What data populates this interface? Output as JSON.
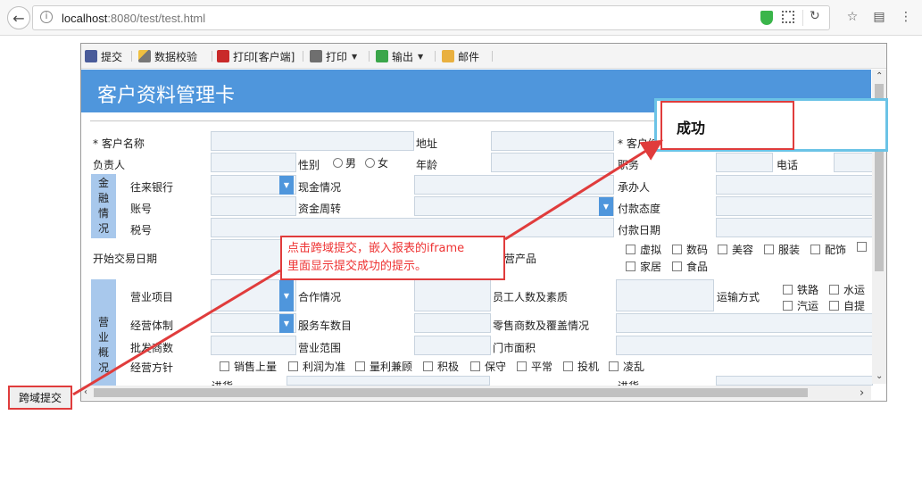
{
  "browser": {
    "url_host": "localhost",
    "url_path": ":8080/test/test.html"
  },
  "toolbar": {
    "submit": "提交",
    "validate": "数据校验",
    "print_client": "打印[客户端]",
    "print": "打印",
    "export": "输出",
    "mail": "邮件"
  },
  "form": {
    "title": "客户资料管理卡",
    "customer_name": "* 客户名称",
    "address": "地址",
    "customer_no": "* 客户编",
    "owner": "负责人",
    "gender": "性别",
    "male": "男",
    "female": "女",
    "age": "年龄",
    "position": "职务",
    "phone": "电话",
    "finance_side": [
      "金",
      "融",
      "情",
      "况"
    ],
    "bank": "往来银行",
    "cash": "现金情况",
    "handler": "承办人",
    "account": "账号",
    "capital_turnover": "资金周转",
    "payment_attitude": "付款态度",
    "tax_no": "税号",
    "payment_date": "付款日期",
    "trade_start": "开始交易日期",
    "products_label": "营产品",
    "products": [
      "虚拟",
      "数码",
      "美容",
      "服装",
      "配饰",
      "家居",
      "食品"
    ],
    "business_side": [
      "营",
      "业",
      "概",
      "况"
    ],
    "business_item": "营业项目",
    "partner": "合作情况",
    "staff": "员工人数及素质",
    "transport": "运输方式",
    "transport_options": [
      "铁路",
      "水运",
      "汽运",
      "自提"
    ],
    "business_type": "经营体制",
    "service_vehicles": "服务车数目",
    "retailers": "零售商数及覆盖情况",
    "wholesalers": "批发商数",
    "business_scope": "营业范围",
    "store_area": "门市面积",
    "policy": "经营方针",
    "policy_options": [
      "销售上量",
      "利润为准",
      "量利兼顾",
      "积极",
      "保守",
      "平常",
      "投机",
      "凌乱"
    ],
    "purchase_left": "进货",
    "purchase_right": "进货"
  },
  "popup": {
    "message": "成功"
  },
  "annotation": {
    "line1": "点击跨域提交，嵌入报表的iframe",
    "line2": "里面显示提交成功的提示。"
  },
  "cross_submit_button": "跨域提交",
  "colors": {
    "banner": "#4f96dc",
    "side_label": "#a8c8ec",
    "annotation_red": "#e03c3c",
    "popup_border": "#6bc3e6"
  }
}
